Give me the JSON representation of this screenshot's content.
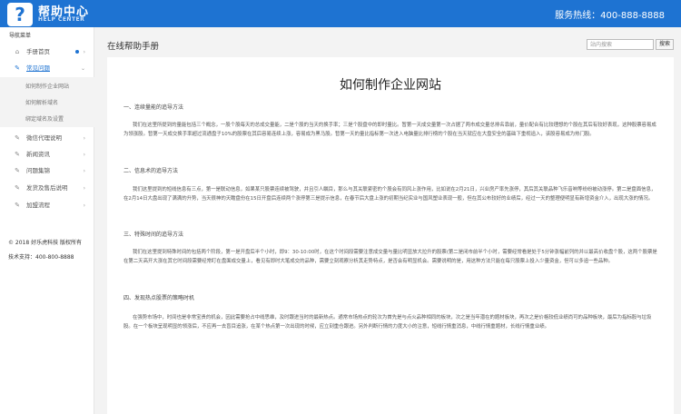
{
  "header": {
    "logo_glyph": "?",
    "title": "帮助中心",
    "subtitle": "HELP CENTER",
    "hotline": "服务热线：400-888-8888"
  },
  "sidebar": {
    "nav_title": "导航菜单",
    "items": [
      {
        "label": "手册首页",
        "icon": "home-icon"
      },
      {
        "label": "常见问题",
        "icon": "edit-icon"
      },
      {
        "label": "微信代理说明",
        "icon": "edit-icon"
      },
      {
        "label": "新闻资讯",
        "icon": "edit-icon"
      },
      {
        "label": "问题集锦",
        "icon": "edit-icon"
      },
      {
        "label": "发货及售后说明",
        "icon": "edit-icon"
      },
      {
        "label": "加盟流程",
        "icon": "edit-icon"
      }
    ],
    "sub_items": [
      "如何制作企业网站",
      "如何解析域名",
      "绑定域名及设置"
    ],
    "copyright": "© 2018 好乐虎科技 版权所有",
    "support": "技术支持：400-800-8888"
  },
  "main": {
    "page_title": "在线帮助手册",
    "search_placeholder": "站内搜索",
    "search_button": "搜索",
    "article": {
      "title": "如何制作企业网站",
      "sections": [
        {
          "heading": "一、连续量能的追导方法",
          "body": "我们在这里所提到的量能包括三个概念，一股个股每天的总成交量能，二是个股的当天的换手率；三是个股盘中的即时量比。暂第一天成交量第一次占据了两市成交量总排名靠前，量价配合有比较理想的个股在其后有较好表现，这种股票容易成为领涨股。暂第一天成交换手率超过流通盘子10%的股票在其后容易连续上涨，容易成为黑马股。暂第一天的量比指标第一次进入电脑量比排行榜的个股在当天就应在大盘安全的基础下重视追入，该股容易成为热门股。"
        },
        {
          "heading": "二、信息术的追导方法",
          "body": "我们这里提到的短线信息有三点，第一是联动信息，如果某只股票连续被驾驶，并且引人瞩目，那么与其关联紧密的个股会有同风上涨作用，比如说在2月21日，兴业房产率先涨停，其后其关联品种飞乐音响等纷纷被动涨停。第二是盘面信息，在2月14日大盘出现了满满的升势，当天很神的天瞻盘份在15日开盘后连续两个涨停第三是提示信息，在春节后大盘上涨的初期当纪实业与国风塑业表现一般，但在其公布较好的业绩后，经过一天的整理便明显有新增资金介入，出现大涨的情况。"
        },
        {
          "heading": "三、特殊时间的追导方法",
          "body": "我们在这里提到特殊时间的包括两个阶段，第一是开盘后半个小时，即9：30-10:00时，在这个时间段需要注意成交量与量比明显放大拉升的股票(第二是闭市前半个小时，需要经常看是处于5分钟涨幅前列的并以最高价收盘个股，这两个股票是在第二天高开大涨在其它时间段需要经常盯在盘面成交量上，看见有即时大笔成交的品种，需要立刻观察分析其走势特点，是否会有明显机会。需要说明的是，用这种方法只能在每只股票上投入少量资金，但可以多追一些品种。"
        },
        {
          "heading": "四、发现热点股票的策略时机",
          "body": "在强势市场中，时间也是非常宝贵的机会，因此需要抢占中线思维，及时跟进当时的最新热点。通常市场热点的轮次为首先是与点火品种相同的板块，次之是当年潜在的题材板块，再次之是价格较低业绩尚可的品种板块，最后为指标股与垃圾股。在一个板块呈现明显的领涨后，不应再一去盲目追涨，在某个热点第一次出现的时候，应立刻重仓跟进。另外判断行情的力度大小的注意，短线行情重消息，中线行情重题材，长线行情重业绩。"
        }
      ]
    }
  },
  "colors": {
    "brand_blue": "#1e73d2",
    "page_bg": "#f3f3f3"
  }
}
